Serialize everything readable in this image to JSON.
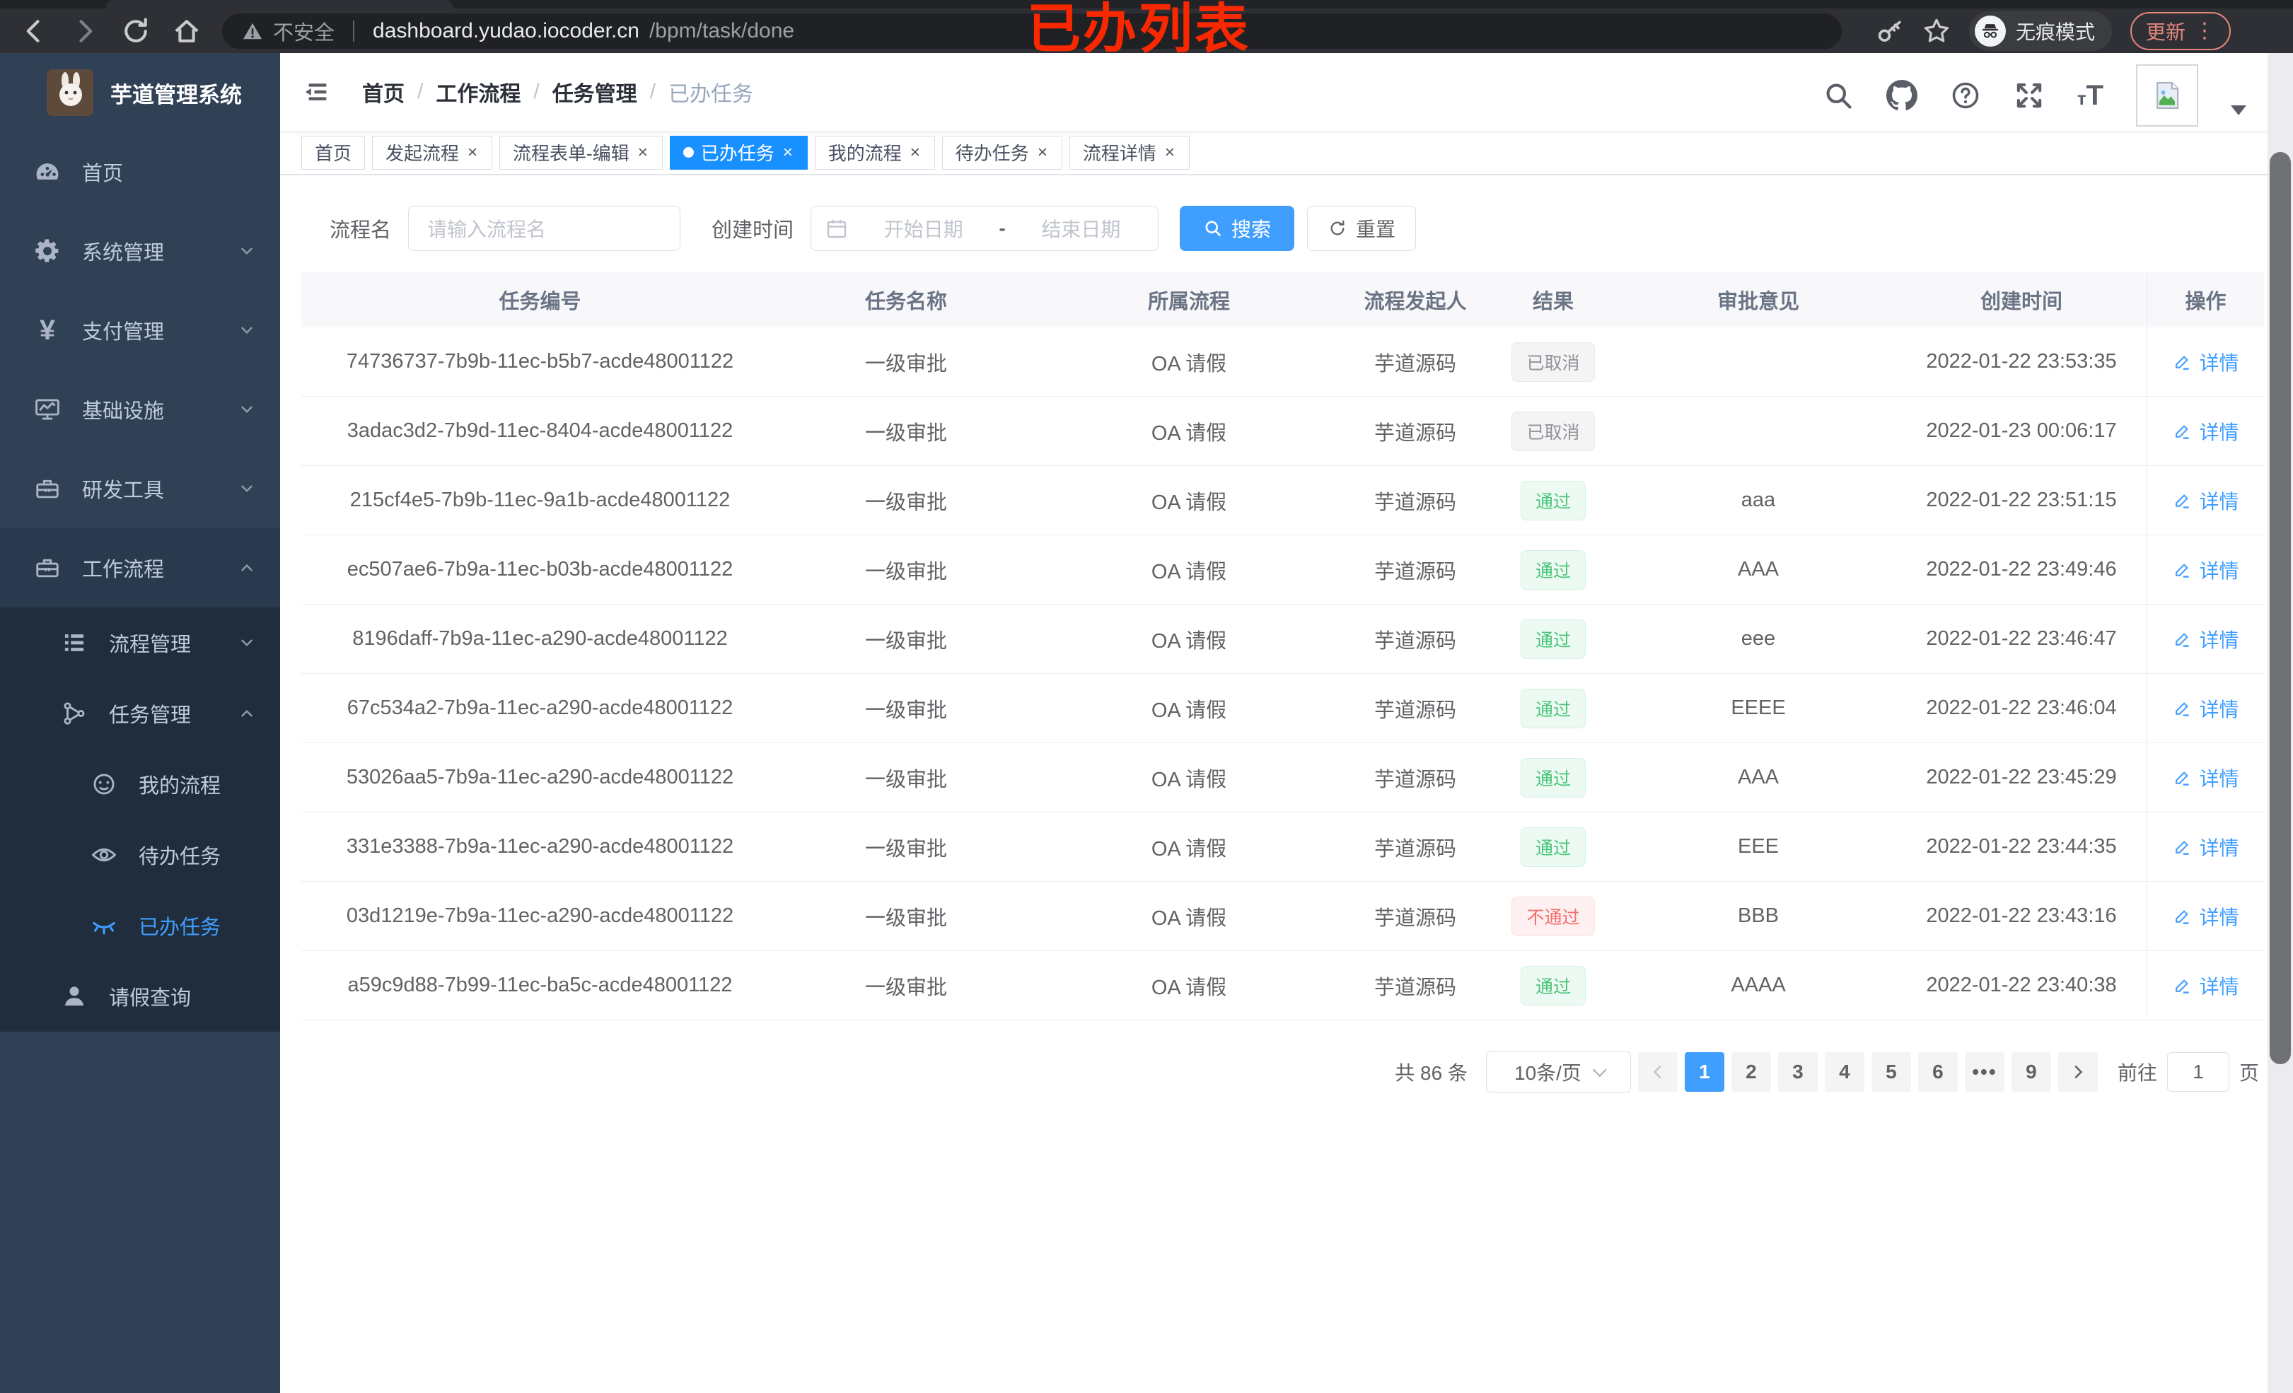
{
  "browser": {
    "security_label": "不安全",
    "url_host": "dashboard.yudao.iocoder.cn",
    "url_path": "/bpm/task/done",
    "incognito_label": "无痕模式",
    "update_label": "更新",
    "annotation": "已办列表"
  },
  "icons": {
    "close_glyph": "×",
    "dots_glyph": "⋮"
  },
  "sidebar": {
    "title": "芋道管理系统",
    "items": [
      {
        "label": "首页"
      },
      {
        "label": "系统管理"
      },
      {
        "label": "支付管理"
      },
      {
        "label": "基础设施"
      },
      {
        "label": "研发工具"
      },
      {
        "label": "工作流程"
      }
    ],
    "workflow_children": [
      {
        "label": "流程管理"
      },
      {
        "label": "任务管理"
      },
      {
        "label": "请假查询"
      }
    ],
    "task_children": [
      {
        "label": "我的流程"
      },
      {
        "label": "待办任务"
      },
      {
        "label": "已办任务",
        "active": true
      }
    ]
  },
  "header": {
    "breadcrumb": [
      "首页",
      "工作流程",
      "任务管理",
      "已办任务"
    ],
    "breadcrumb_separator": "/"
  },
  "tabs": [
    {
      "label": "首页",
      "closable": false,
      "active": false
    },
    {
      "label": "发起流程",
      "closable": true,
      "active": false
    },
    {
      "label": "流程表单-编辑",
      "closable": true,
      "active": false
    },
    {
      "label": "已办任务",
      "closable": true,
      "active": true
    },
    {
      "label": "我的流程",
      "closable": true,
      "active": false
    },
    {
      "label": "待办任务",
      "closable": true,
      "active": false
    },
    {
      "label": "流程详情",
      "closable": true,
      "active": false
    }
  ],
  "filters": {
    "name_label": "流程名",
    "name_placeholder": "请输入流程名",
    "time_label": "创建时间",
    "start_placeholder": "开始日期",
    "range_separator": "-",
    "end_placeholder": "结束日期",
    "search_label": "搜索",
    "reset_label": "重置"
  },
  "table": {
    "columns": [
      "任务编号",
      "任务名称",
      "所属流程",
      "流程发起人",
      "结果",
      "审批意见",
      "创建时间",
      "操作"
    ],
    "action_label": "详情",
    "rows": [
      {
        "id": "74736737-7b9b-11ec-b5b7-acde48001122",
        "name": "一级审批",
        "process": "OA 请假",
        "starter": "芋道源码",
        "result": "已取消",
        "result_type": "info",
        "comment": "",
        "created": "2022-01-22 23:53:35"
      },
      {
        "id": "3adac3d2-7b9d-11ec-8404-acde48001122",
        "name": "一级审批",
        "process": "OA 请假",
        "starter": "芋道源码",
        "result": "已取消",
        "result_type": "info",
        "comment": "",
        "created": "2022-01-23 00:06:17"
      },
      {
        "id": "215cf4e5-7b9b-11ec-9a1b-acde48001122",
        "name": "一级审批",
        "process": "OA 请假",
        "starter": "芋道源码",
        "result": "通过",
        "result_type": "success",
        "comment": "aaa",
        "created": "2022-01-22 23:51:15"
      },
      {
        "id": "ec507ae6-7b9a-11ec-b03b-acde48001122",
        "name": "一级审批",
        "process": "OA 请假",
        "starter": "芋道源码",
        "result": "通过",
        "result_type": "success",
        "comment": "AAA",
        "created": "2022-01-22 23:49:46"
      },
      {
        "id": "8196daff-7b9a-11ec-a290-acde48001122",
        "name": "一级审批",
        "process": "OA 请假",
        "starter": "芋道源码",
        "result": "通过",
        "result_type": "success",
        "comment": "eee",
        "created": "2022-01-22 23:46:47"
      },
      {
        "id": "67c534a2-7b9a-11ec-a290-acde48001122",
        "name": "一级审批",
        "process": "OA 请假",
        "starter": "芋道源码",
        "result": "通过",
        "result_type": "success",
        "comment": "EEEE",
        "created": "2022-01-22 23:46:04"
      },
      {
        "id": "53026aa5-7b9a-11ec-a290-acde48001122",
        "name": "一级审批",
        "process": "OA 请假",
        "starter": "芋道源码",
        "result": "通过",
        "result_type": "success",
        "comment": "AAA",
        "created": "2022-01-22 23:45:29"
      },
      {
        "id": "331e3388-7b9a-11ec-a290-acde48001122",
        "name": "一级审批",
        "process": "OA 请假",
        "starter": "芋道源码",
        "result": "通过",
        "result_type": "success",
        "comment": "EEE",
        "created": "2022-01-22 23:44:35"
      },
      {
        "id": "03d1219e-7b9a-11ec-a290-acde48001122",
        "name": "一级审批",
        "process": "OA 请假",
        "starter": "芋道源码",
        "result": "不通过",
        "result_type": "danger",
        "comment": "BBB",
        "created": "2022-01-22 23:43:16"
      },
      {
        "id": "a59c9d88-7b99-11ec-ba5c-acde48001122",
        "name": "一级审批",
        "process": "OA 请假",
        "starter": "芋道源码",
        "result": "通过",
        "result_type": "success",
        "comment": "AAAA",
        "created": "2022-01-22 23:40:38"
      }
    ]
  },
  "pagination": {
    "total_label": "共 86 条",
    "page_size": "10条/页",
    "pages": [
      "1",
      "2",
      "3",
      "4",
      "5",
      "6",
      "•••",
      "9"
    ],
    "active_page": "1",
    "goto_label": "前往",
    "goto_value": "1",
    "goto_suffix": "页"
  },
  "colors": {
    "accent": "#409eff",
    "tab_active": "#1890ff",
    "success_text": "#49c579",
    "success_bg": "#edfaf3",
    "danger_text": "#f56c6c",
    "danger_bg": "#fef0f0",
    "info_text": "#909399",
    "info_bg": "#f4f4f5",
    "annotation_red": "#fa2800",
    "sidebar_bg": "#304156",
    "submenu_bg": "#1f2d3d"
  }
}
